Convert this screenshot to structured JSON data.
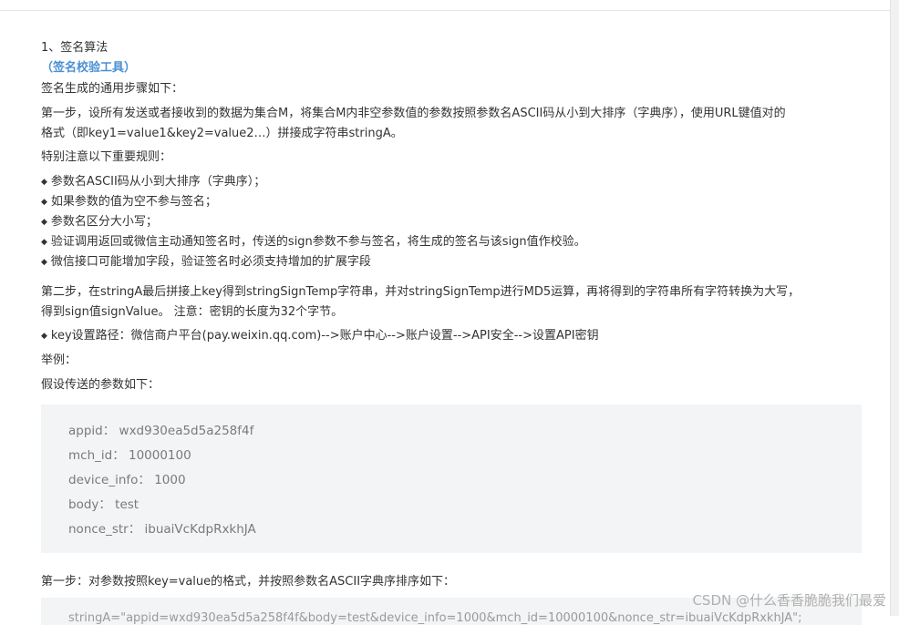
{
  "section_title": "1、签名算法",
  "tool_link": "（签名校验工具）",
  "intro": "签名生成的通用步骤如下：",
  "step1_line1": "第一步，设所有发送或者接收到的数据为集合M，将集合M内非空参数值的参数按照参数名ASCII码从小到大排序（字典序），使用URL键值对的",
  "step1_line2": "格式（即key1=value1&key2=value2…）拼接成字符串stringA。",
  "rules_heading": "特别注意以下重要规则：",
  "rules": [
    "参数名ASCII码从小到大排序（字典序）；",
    "如果参数的值为空不参与签名；",
    "参数名区分大小写；",
    "验证调用返回或微信主动通知签名时，传送的sign参数不参与签名，将生成的签名与该sign值作校验。",
    "微信接口可能增加字段，验证签名时必须支持增加的扩展字段"
  ],
  "step2_line1": "第二步，在stringA最后拼接上key得到stringSignTemp字符串，并对stringSignTemp进行MD5运算，再将得到的字符串所有字符转换为大写，",
  "step2_line2": "得到sign值signValue。 注意：密钥的长度为32个字节。",
  "key_path": "key设置路径：微信商户平台(pay.weixin.qq.com)-->账户中心-->账户设置-->API安全-->设置API密钥",
  "example_label": "举例：",
  "params_intro": "假设传送的参数如下：",
  "params": [
    "appid： wxd930ea5d5a258f4f",
    "mch_id： 10000100",
    "device_info： 1000",
    "body： test",
    "nonce_str： ibuaiVcKdpRxkhJA"
  ],
  "step_sort": "第一步：对参数按照key=value的格式，并按照参数名ASCII字典序排序如下：",
  "sorted_preview": "stringA=\"appid=wxd930ea5d5a258f4f&body=test&device_info=1000&mch_id=10000100&nonce_str=ibuaiVcKdpRxkhJA\";",
  "watermark": "CSDN @什么香香脆脆我们最爱"
}
